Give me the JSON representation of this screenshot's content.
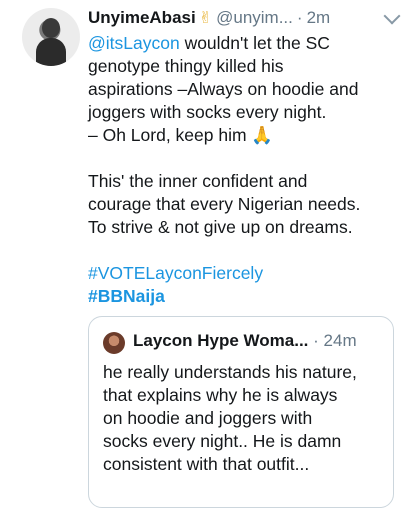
{
  "tweet": {
    "author_name": "UnyimeAbasi",
    "author_emoji": "✌",
    "handle": "@unyim...",
    "separator": "·",
    "time": "2m",
    "lines": [
      {
        "parts": [
          {
            "t": "@itsLaycon",
            "k": "mention"
          },
          {
            "t": " wouldn't let the SC",
            "k": "plain"
          }
        ]
      },
      {
        "parts": [
          {
            "t": "genotype thingy killed his",
            "k": "plain"
          }
        ]
      },
      {
        "parts": [
          {
            "t": "aspirations –Always on hoodie and",
            "k": "plain"
          }
        ]
      },
      {
        "parts": [
          {
            "t": "joggers with socks every night.",
            "k": "plain"
          }
        ]
      },
      {
        "parts": [
          {
            "t": "– Oh Lord, keep him ",
            "k": "plain"
          },
          {
            "t": "🙏",
            "k": "pray"
          }
        ]
      },
      {
        "gap": true
      },
      {
        "parts": [
          {
            "t": "This' the inner confident and",
            "k": "plain"
          }
        ]
      },
      {
        "parts": [
          {
            "t": "courage that every Nigerian needs.",
            "k": "plain"
          }
        ]
      },
      {
        "parts": [
          {
            "t": "To strive & not give up on dreams.",
            "k": "plain"
          }
        ]
      },
      {
        "gap": true
      },
      {
        "parts": [
          {
            "t": "#VOTELayconFiercely",
            "k": "hashtag"
          }
        ]
      },
      {
        "parts": [
          {
            "t": "#BBNaija",
            "k": "bold-link"
          }
        ]
      }
    ]
  },
  "quoted_tweet": {
    "author_name": "Laycon Hype Woma...",
    "separator": "·",
    "time": "24m",
    "lines": [
      "he really understands his nature,",
      "that explains why he is always",
      "on hoodie and joggers with",
      "socks every night.. He is damn",
      "consistent with that outfit..."
    ]
  }
}
